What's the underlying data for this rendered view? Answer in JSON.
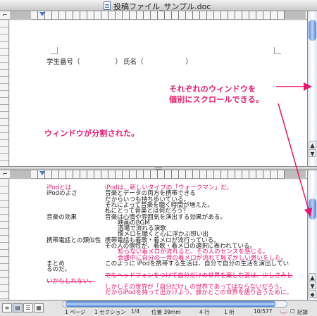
{
  "window": {
    "title": "投稿ファイル_サンプル.doc"
  },
  "top_pane": {
    "fields": [
      {
        "label": "学生番号（",
        "close": "）"
      },
      {
        "label": "氏名（",
        "close": "）"
      }
    ]
  },
  "annotations": {
    "scroll_note_line1": "それぞれのウィンドウを",
    "scroll_note_line2": "個別にスクロールできる。",
    "split_note": "ウィンドウが分割された。",
    "accent_color": "#e8176e"
  },
  "bottom_pane": {
    "lines": [
      {
        "left": "iPodとは",
        "right": "iPodは、新しいタイプの「ウォークマン」だ。",
        "style": "pink"
      },
      {
        "left": "iPodのよさ",
        "right": "音楽とデータの両方を携帯できる",
        "style": "normal"
      },
      {
        "left": "",
        "right": "だからいつも持ち歩いている。",
        "style": "normal"
      },
      {
        "left": "",
        "right": "それによって音楽を聴く時間が増えた。",
        "style": "normal"
      },
      {
        "left": "",
        "right": "私にとって音楽とは何だろう？",
        "style": "normal"
      },
      {
        "left": "音楽の効果",
        "right": "音楽は心情や雰囲気を演出する効果がある。",
        "style": "normal"
      },
      {
        "left": "",
        "right": "映画のBGM",
        "style": "indent"
      },
      {
        "left": "",
        "right": "酒場で流れる演歌",
        "style": "indent"
      },
      {
        "left": "",
        "right": "懐メロを聴くと心に浮かぶ想い出",
        "style": "indent"
      },
      {
        "left": "携帯電話との類似性",
        "right": "携帯電話も着歌・着メロが流行っている。",
        "style": "normal"
      },
      {
        "left": "",
        "right": "その人の個性が、着歌・着メロの選択に表われている。",
        "style": "normal"
      },
      {
        "left": "",
        "right": "知らない着メロが流れると、その人のセンスを感じる。",
        "style": "pinkindent"
      },
      {
        "left": "",
        "right": "会議中に自分の一昔の着メロが流れて恥ずかしい思いをした。",
        "style": "pinkindent"
      },
      {
        "left": "まとめ",
        "right": "このように iPodを携帯する生活は、自分で自分の生活を演出してい",
        "style": "normal"
      },
      {
        "left": "るのだ。",
        "right": "",
        "style": "normal"
      },
      {
        "left": "",
        "right": "でもヘッドフォンをつけて自分だけの世界を楽しむ姿は、少しさみし",
        "style": "strike"
      },
      {
        "left": "いかもしれない。",
        "right": "",
        "style": "strike"
      },
      {
        "left": "",
        "right": "しかしその世界が「自分だけ」の世界であってはならないだろう。",
        "style": "pink"
      },
      {
        "left": "",
        "right": "だからiPodを持って出かけよう。誰かとこの世界を語り合うために。",
        "style": "pink"
      }
    ]
  },
  "status": {
    "page": "1 ページ",
    "section": "1 セクション",
    "pages": "1/4",
    "position": "位置 39mm",
    "line": "4 行",
    "column": "1 桁",
    "words": "10/577",
    "record": "記録"
  },
  "icons": {
    "view_normal": "normal-view-icon",
    "view_outline": "outline-view-icon",
    "view_page": "page-layout-icon",
    "view_notebook": "notebook-view-icon"
  }
}
